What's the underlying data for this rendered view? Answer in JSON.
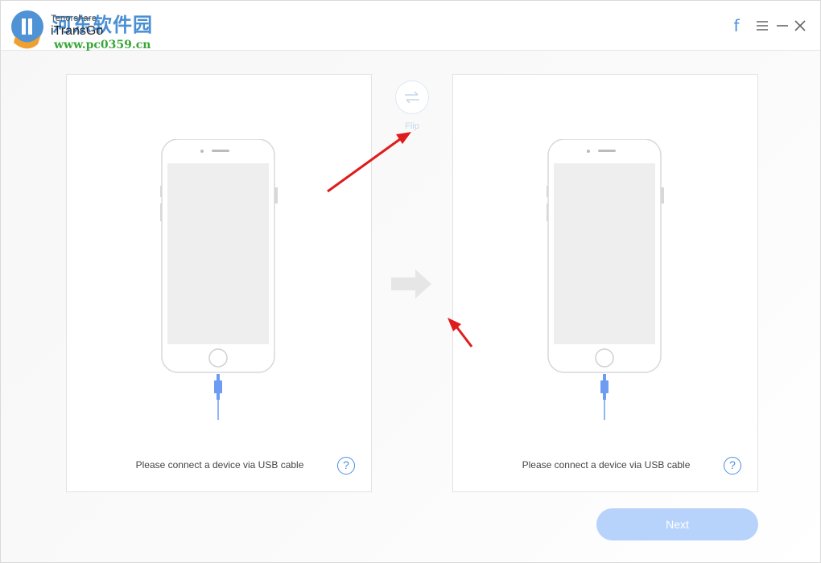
{
  "titlebar": {
    "brand_small": "Tenorshare",
    "app_name": "iTransGo",
    "watermark_cn": "河东软件园",
    "watermark_url": "www.pc0359.cn",
    "facebook_glyph": "f"
  },
  "icons": {
    "facebook": "facebook-icon",
    "menu": "hamburger-menu-icon",
    "minimize": "minimize-icon",
    "close": "close-icon",
    "flip": "swap-arrows-icon",
    "direction": "right-arrow-icon",
    "help": "question-mark-icon"
  },
  "flip": {
    "label": "Flip"
  },
  "panels": {
    "source": {
      "message": "Please connect a device via USB cable",
      "help": "?"
    },
    "target": {
      "message": "Please connect a device via USB cable",
      "help": "?"
    }
  },
  "footer": {
    "next_label": "Next"
  },
  "colors": {
    "accent": "#4a8fe0",
    "next_disabled": "#b7d3fb",
    "annotation_arrow": "#e01b1b",
    "cable": "#6d9cf2"
  }
}
